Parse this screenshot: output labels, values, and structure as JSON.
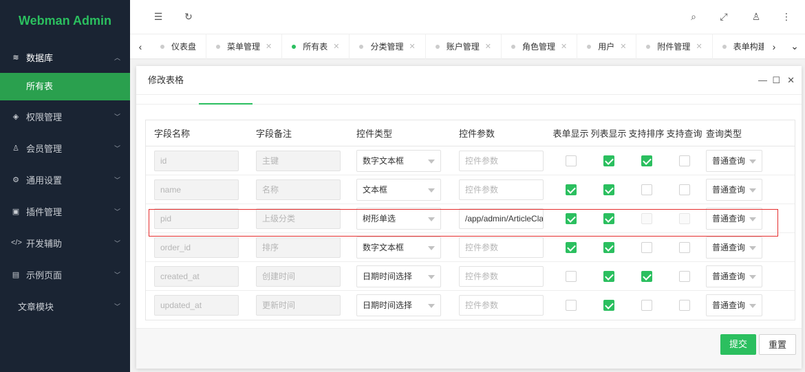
{
  "app_title": "Webman Admin",
  "sidebar": {
    "items": [
      {
        "label": "数据库",
        "icon": "layers-icon",
        "open": true
      },
      {
        "label": "权限管理",
        "icon": "shield-icon"
      },
      {
        "label": "会员管理",
        "icon": "user-icon"
      },
      {
        "label": "通用设置",
        "icon": "gear-icon"
      },
      {
        "label": "插件管理",
        "icon": "plugin-icon"
      },
      {
        "label": "开发辅助",
        "icon": "code-icon"
      },
      {
        "label": "示例页面",
        "icon": "page-icon"
      },
      {
        "label": "文章模块",
        "icon": ""
      }
    ],
    "sub_active": "所有表"
  },
  "tabs": [
    {
      "label": "仪表盘",
      "closable": false
    },
    {
      "label": "菜单管理",
      "closable": true
    },
    {
      "label": "所有表",
      "closable": true,
      "active": true
    },
    {
      "label": "分类管理",
      "closable": true
    },
    {
      "label": "账户管理",
      "closable": true
    },
    {
      "label": "角色管理",
      "closable": true
    },
    {
      "label": "用户",
      "closable": true
    },
    {
      "label": "附件管理",
      "closable": true
    },
    {
      "label": "表单构建",
      "closable": true
    }
  ],
  "dialog": {
    "title": "修改表格",
    "columns": {
      "field": "字段名称",
      "note": "字段备注",
      "control": "控件类型",
      "param": "控件参数",
      "form_show": "表单显示",
      "list_show": "列表显示",
      "sortable": "支持排序",
      "searchable": "支持查询",
      "query_type": "查询类型"
    },
    "rows": [
      {
        "field": "id",
        "note": "主键",
        "control": "数字文本框",
        "param": "",
        "param_placeholder": "控件参数",
        "form_show": false,
        "list_show": true,
        "sortable": true,
        "searchable": false,
        "query_type": "普通查询"
      },
      {
        "field": "name",
        "note": "名称",
        "control": "文本框",
        "param": "",
        "param_placeholder": "控件参数",
        "form_show": true,
        "list_show": true,
        "sortable": false,
        "searchable": false,
        "query_type": "普通查询"
      },
      {
        "field": "pid",
        "note": "上级分类",
        "control": "树形单选",
        "param": "/app/admin/ArticleClas",
        "param_placeholder": "控件参数",
        "form_show": true,
        "list_show": true,
        "sortable": false,
        "searchable": false,
        "query_type": "普通查询"
      },
      {
        "field": "order_id",
        "note": "排序",
        "control": "数字文本框",
        "param": "",
        "param_placeholder": "控件参数",
        "form_show": true,
        "list_show": true,
        "sortable": false,
        "searchable": false,
        "query_type": "普通查询"
      },
      {
        "field": "created_at",
        "note": "创建时间",
        "control": "日期时间选择",
        "param": "",
        "param_placeholder": "控件参数",
        "form_show": false,
        "list_show": true,
        "sortable": true,
        "searchable": false,
        "query_type": "普通查询"
      },
      {
        "field": "updated_at",
        "note": "更新时间",
        "control": "日期时间选择",
        "param": "",
        "param_placeholder": "控件参数",
        "form_show": false,
        "list_show": true,
        "sortable": false,
        "searchable": false,
        "query_type": "普通查询"
      }
    ],
    "submit_label": "提交",
    "reset_label": "重置"
  },
  "colors": {
    "accent": "#2bbf5f",
    "sidebar_bg": "#1a2433",
    "highlight": "#e52d2d"
  }
}
